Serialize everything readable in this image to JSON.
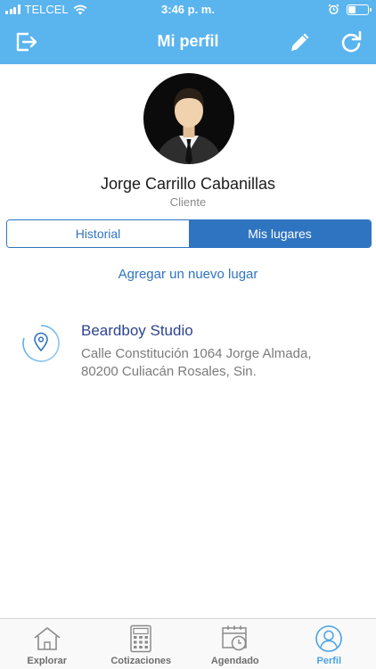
{
  "status_bar": {
    "carrier": "TELCEL",
    "time": "3:46 p. m.",
    "battery_level": 0.35
  },
  "nav": {
    "title": "Mi perfil",
    "left_icon": "logout-icon",
    "right_icons": [
      "pencil-icon",
      "refresh-icon"
    ]
  },
  "profile": {
    "name": "Jorge Carrillo Cabanillas",
    "role": "Cliente",
    "avatar_icon": "businessman-avatar"
  },
  "segments": {
    "options": [
      "Historial",
      "Mis lugares"
    ],
    "selected": "Mis lugares"
  },
  "add_place_label": "Agregar un nuevo lugar",
  "places": [
    {
      "name": "Beardboy Studio",
      "address": "Calle Constitución 1064 Jorge Almada, 80200 Culiacán Rosales, Sin.",
      "icon": "location-pin-icon"
    }
  ],
  "tabbar": {
    "items": [
      {
        "label": "Explorar",
        "icon": "house-icon"
      },
      {
        "label": "Cotizaciones",
        "icon": "calculator-icon"
      },
      {
        "label": "Agendado",
        "icon": "calendar-clock-icon"
      },
      {
        "label": "Perfil",
        "icon": "user-circle-icon"
      }
    ],
    "active": "Perfil"
  },
  "colors": {
    "header": "#5ab4ee",
    "accent": "#2f74c0",
    "place_name": "#2e4390",
    "tab_active": "#4aa3e8"
  }
}
